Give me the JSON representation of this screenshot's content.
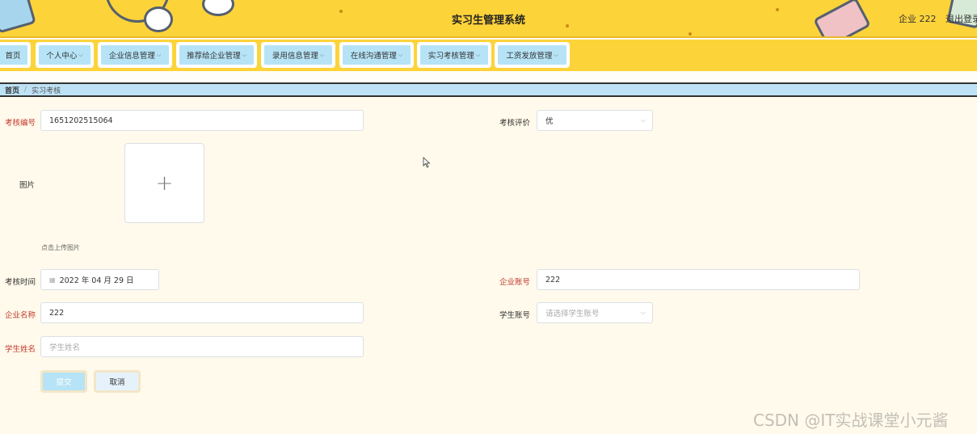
{
  "header": {
    "title": "实习生管理系统",
    "user": "企业 222",
    "logout": "退出登录"
  },
  "nav": [
    {
      "label": "首页",
      "chevron": false
    },
    {
      "label": "个人中心",
      "chevron": true
    },
    {
      "label": "企业信息管理",
      "chevron": true
    },
    {
      "label": "推荐给企业管理",
      "chevron": true
    },
    {
      "label": "录用信息管理",
      "chevron": true
    },
    {
      "label": "在线沟通管理",
      "chevron": true
    },
    {
      "label": "实习考核管理",
      "chevron": true
    },
    {
      "label": "工资发放管理",
      "chevron": true
    }
  ],
  "breadcrumb": {
    "home": "首页",
    "sep": "/",
    "current": "实习考核"
  },
  "form": {
    "exam_no_label": "考核编号",
    "exam_no_value": "1651202515064",
    "rating_label": "考核评价",
    "rating_value": "优",
    "image_label": "图片",
    "upload_hint": "点击上传图片",
    "exam_time_label": "考核时间",
    "exam_time_value": "2022 年 04 月 29 日",
    "company_account_label": "企业账号",
    "company_account_value": "222",
    "company_name_label": "企业名称",
    "company_name_value": "222",
    "student_account_label": "学生账号",
    "student_account_placeholder": "请选择学生账号",
    "student_name_label": "学生姓名",
    "student_name_placeholder": "学生姓名",
    "submit_label": "提交",
    "cancel_label": "取消"
  },
  "watermark": "CSDN @IT实战课堂小元酱",
  "colors": {
    "header": "#fdd33a",
    "nav_item": "#b6e3f6",
    "page_bg": "#fffaeb",
    "required": "#c0392b"
  }
}
